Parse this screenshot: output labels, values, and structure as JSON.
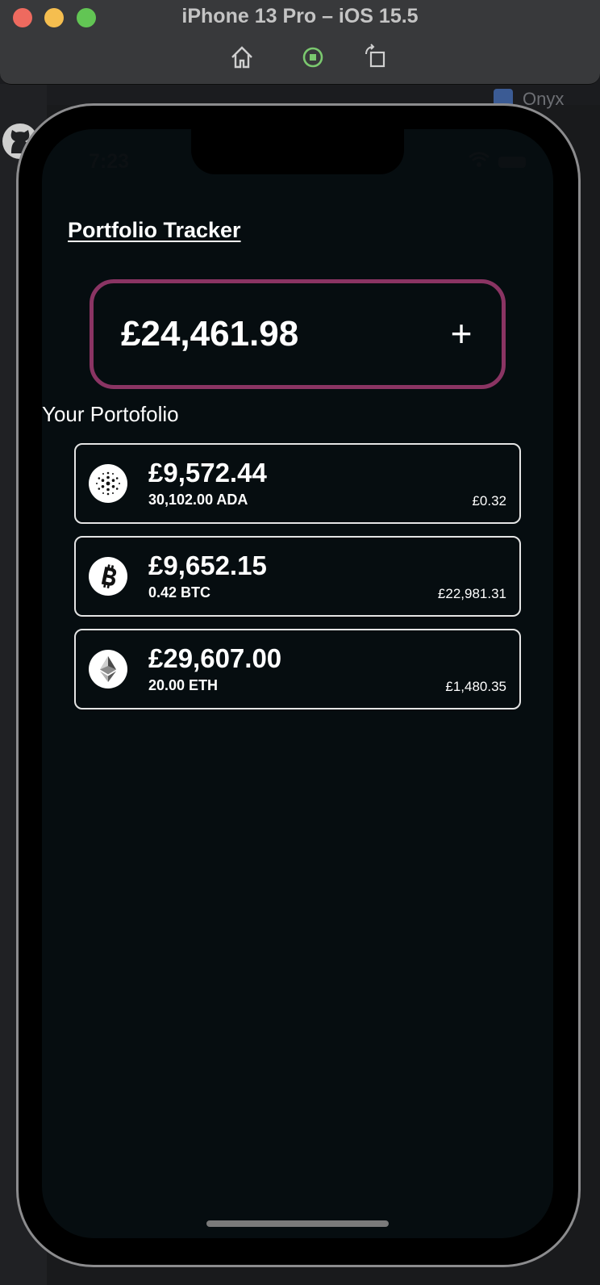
{
  "simulator": {
    "title": "iPhone 13 Pro – iOS 15.5",
    "buttons": [
      "home-icon",
      "stop-icon",
      "rotate-icon"
    ]
  },
  "background": {
    "tab_label": "Onyx"
  },
  "status_bar": {
    "time": "7:23"
  },
  "app": {
    "title": "Portfolio Tracker",
    "total_value": "£24,461.98",
    "add_label": "+",
    "section_title": "Your Portofolio",
    "accent_color": "#8a3463",
    "holdings": [
      {
        "icon": "cardano-icon",
        "value": "£9,572.44",
        "amount": "30,102.00 ADA",
        "price": "£0.32"
      },
      {
        "icon": "bitcoin-icon",
        "value": "£9,652.15",
        "amount": "0.42 BTC",
        "price": "£22,981.31"
      },
      {
        "icon": "ethereum-icon",
        "value": "£29,607.00",
        "amount": "20.00 ETH",
        "price": "£1,480.35"
      }
    ]
  }
}
